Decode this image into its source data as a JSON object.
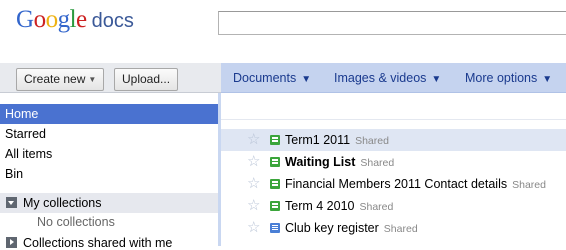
{
  "header": {
    "logo_google": "Google",
    "logo_docs": "docs",
    "search_value": ""
  },
  "toolbar": {
    "create_new": "Create new",
    "upload": "Upload..."
  },
  "menubar": [
    {
      "label": "Documents"
    },
    {
      "label": "Images & videos"
    },
    {
      "label": "More options"
    }
  ],
  "sidebar": {
    "items": [
      {
        "label": "Home",
        "active": true
      },
      {
        "label": "Starred"
      },
      {
        "label": "All items"
      },
      {
        "label": "Bin"
      }
    ],
    "my_collections": "My collections",
    "no_collections": "No collections",
    "shared_collections": "Collections shared with me"
  },
  "documents": [
    {
      "title": "Term1 2011",
      "type": "spreadsheet",
      "bold": false,
      "status": "Shared",
      "highlighted": true
    },
    {
      "title": "Waiting List",
      "type": "spreadsheet",
      "bold": true,
      "status": "Shared"
    },
    {
      "title": "Financial Members 2011 Contact details",
      "type": "spreadsheet",
      "bold": false,
      "status": "Shared"
    },
    {
      "title": "Term 4 2010",
      "type": "spreadsheet",
      "bold": false,
      "status": "Shared"
    },
    {
      "title": "Club key register",
      "type": "document",
      "bold": false,
      "status": "Shared"
    }
  ],
  "colors": {
    "accent": "#4a72d0",
    "toolbar": "#c5d3ef",
    "link": "#1a3a8e",
    "sheet_icon": "#3ba53b",
    "doc_icon": "#4a7fd6"
  }
}
